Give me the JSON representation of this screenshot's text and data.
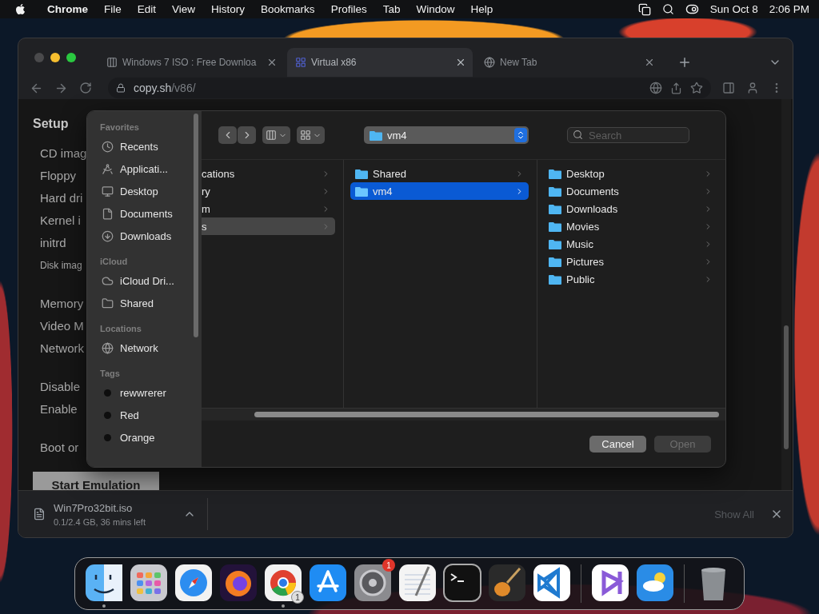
{
  "menu_bar": {
    "app": "Chrome",
    "menus": [
      "File",
      "Edit",
      "View",
      "History",
      "Bookmarks",
      "Profiles",
      "Tab",
      "Window",
      "Help"
    ],
    "date": "Sun Oct 8",
    "time": "2:06 PM"
  },
  "browser": {
    "tabs": [
      {
        "title": "Windows 7 ISO : Free Downloa",
        "selected": false
      },
      {
        "title": "Virtual x86",
        "selected": true
      },
      {
        "title": "New Tab",
        "selected": false
      }
    ],
    "address": {
      "host": "copy.sh",
      "path": "/v86/"
    }
  },
  "page": {
    "heading": "Setup",
    "sections": [
      [
        {
          "label": "CD imag",
          "kind": "option"
        },
        {
          "label": "Floppy",
          "kind": "option"
        },
        {
          "label": "Hard dri",
          "kind": "option"
        },
        {
          "label": "Kernel i",
          "kind": "option"
        },
        {
          "label": "initrd",
          "kind": "option"
        },
        {
          "label": "Disk imag",
          "kind": "note"
        }
      ],
      [
        {
          "label": "Memory",
          "kind": "option"
        },
        {
          "label": "Video M",
          "kind": "option"
        },
        {
          "label": "Network",
          "kind": "option"
        }
      ],
      [
        {
          "label": "Disable",
          "kind": "option"
        },
        {
          "label": "Enable",
          "kind": "option"
        }
      ],
      [
        {
          "label": "Boot or",
          "kind": "option"
        }
      ]
    ],
    "button": "Start Emulation"
  },
  "dialog": {
    "sidebar": [
      {
        "heading": "Favorites",
        "kind": "places",
        "items": [
          "Recents",
          "Applicati...",
          "Desktop",
          "Documents",
          "Downloads"
        ]
      },
      {
        "heading": "iCloud",
        "kind": "places",
        "items": [
          "iCloud Dri...",
          "Shared"
        ]
      },
      {
        "heading": "Locations",
        "kind": "places",
        "items": [
          "Network"
        ]
      },
      {
        "heading": "Tags",
        "kind": "tags",
        "items": [
          "rewwrerer",
          "Red",
          "Orange"
        ]
      }
    ],
    "path": "vm4",
    "search": {
      "placeholder": "Search"
    },
    "columns": [
      {
        "active": false,
        "clipped": true,
        "rows": [
          {
            "label": "cations",
            "selected": false
          },
          {
            "label": "ry",
            "selected": false
          },
          {
            "label": "m",
            "selected": false
          },
          {
            "label": "s",
            "selected": true
          }
        ]
      },
      {
        "active": true,
        "clipped": false,
        "rows": [
          {
            "label": "Shared",
            "selected": false
          },
          {
            "label": "vm4",
            "selected": true
          }
        ]
      },
      {
        "clipped": false,
        "rows": [
          {
            "label": "Desktop",
            "selected": false
          },
          {
            "label": "Documents",
            "selected": false
          },
          {
            "label": "Downloads",
            "selected": false
          },
          {
            "label": "Movies",
            "selected": false
          },
          {
            "label": "Music",
            "selected": false
          },
          {
            "label": "Pictures",
            "selected": false
          },
          {
            "label": "Public",
            "selected": false
          }
        ]
      }
    ],
    "cancel": {
      "label": "Cancel"
    },
    "open": {
      "label": "Open",
      "disabled": true
    }
  },
  "download": {
    "file": "Win7Pro32bit.iso",
    "status": "0.1/2.4 GB, 36 mins left",
    "show_all": "Show All"
  },
  "dock": {
    "groups": [
      [
        {
          "running": true
        },
        {
          "running": false
        },
        {
          "running": false
        },
        {
          "running": false
        },
        {
          "running": true,
          "badge": {
            "text": "1",
            "kind": "count"
          }
        },
        {
          "running": false
        },
        {
          "running": false,
          "badge": {
            "text": "1",
            "kind": "alert"
          }
        },
        {
          "running": false
        },
        {
          "running": false
        },
        {
          "running": false
        },
        {
          "running": false
        }
      ],
      [
        {
          "running": false
        },
        {
          "running": false
        }
      ],
      [
        {
          "running": false
        }
      ]
    ]
  }
}
